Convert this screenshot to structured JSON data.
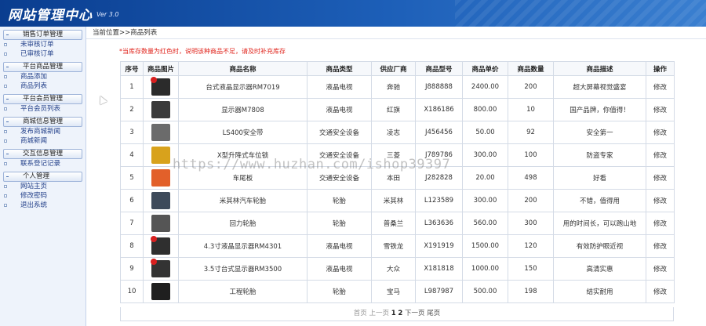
{
  "header": {
    "title": "网站管理中心",
    "version": "Ver 3.0"
  },
  "sidebar": {
    "groups": [
      {
        "title": "销售订单管理",
        "items": [
          "未审核订单",
          "已审核订单"
        ]
      },
      {
        "title": "平台商品管理",
        "items": [
          "商品添加",
          "商品列表"
        ]
      },
      {
        "title": "平台会员管理",
        "items": [
          "平台会员列表"
        ]
      },
      {
        "title": "商城信息管理",
        "items": [
          "发布商城新闻",
          "商城新闻"
        ]
      },
      {
        "title": "交互信息管理",
        "items": [
          "联系登记记录"
        ]
      },
      {
        "title": "个人管理",
        "items": [
          "网站主页",
          "修改密码",
          "退出系统"
        ]
      }
    ]
  },
  "breadcrumb": "当前位置>>商品列表",
  "notice": "*当库存数量为红色时，说明该种商品不足，请及时补充库存",
  "table": {
    "headers": [
      "序号",
      "商品图片",
      "商品名称",
      "商品类型",
      "供应厂商",
      "商品型号",
      "商品单价",
      "商品数量",
      "商品描述",
      "操作"
    ],
    "rows": [
      {
        "no": "1",
        "name": "台式液晶显示器RM7019",
        "type": "液晶电视",
        "vendor": "奔驰",
        "model": "J888888",
        "price": "2400.00",
        "qty": "200",
        "desc": "超大屏幕视觉盛宴",
        "op": "修改",
        "img_color": "#2b2b2b",
        "hot": true,
        "low": false
      },
      {
        "no": "2",
        "name": "显示器M7808",
        "type": "液晶电视",
        "vendor": "红旗",
        "model": "X186186",
        "price": "800.00",
        "qty": "10",
        "desc": "国产品牌，你值得！",
        "op": "修改",
        "img_color": "#3a3a3a",
        "hot": false,
        "low": true
      },
      {
        "no": "3",
        "name": "LS400安全带",
        "type": "交通安全设备",
        "vendor": "凌志",
        "model": "J456456",
        "price": "50.00",
        "qty": "92",
        "desc": "安全第一",
        "op": "修改",
        "img_color": "#6b6b6b",
        "hot": false,
        "low": false
      },
      {
        "no": "4",
        "name": "X型升降式车位锁",
        "type": "交通安全设备",
        "vendor": "三菱",
        "model": "J789786",
        "price": "300.00",
        "qty": "100",
        "desc": "防盗专家",
        "op": "修改",
        "img_color": "#d8a21c",
        "hot": false,
        "low": false
      },
      {
        "no": "5",
        "name": "车尾板",
        "type": "交通安全设备",
        "vendor": "本田",
        "model": "J282828",
        "price": "20.00",
        "qty": "498",
        "desc": "好看",
        "op": "修改",
        "img_color": "#e2602a",
        "hot": false,
        "low": false
      },
      {
        "no": "6",
        "name": "米其林汽车轮胎",
        "type": "轮胎",
        "vendor": "米其林",
        "model": "L123589",
        "price": "300.00",
        "qty": "200",
        "desc": "不错，值得用",
        "op": "修改",
        "img_color": "#3d4a5a",
        "hot": false,
        "low": false
      },
      {
        "no": "7",
        "name": "回力轮胎",
        "type": "轮胎",
        "vendor": "普桑兰",
        "model": "L363636",
        "price": "560.00",
        "qty": "300",
        "desc": "用的时间长，可以跑山地",
        "op": "修改",
        "img_color": "#555555",
        "hot": false,
        "low": false
      },
      {
        "no": "8",
        "name": "4.3寸液晶显示器RM4301",
        "type": "液晶电视",
        "vendor": "雪铁龙",
        "model": "X191919",
        "price": "1500.00",
        "qty": "120",
        "desc": "有效防护眼近视",
        "op": "修改",
        "img_color": "#2f2f2f",
        "hot": true,
        "low": false
      },
      {
        "no": "9",
        "name": "3.5寸台式显示器RM3500",
        "type": "液晶电视",
        "vendor": "大众",
        "model": "X181818",
        "price": "1000.00",
        "qty": "150",
        "desc": "高清实惠",
        "op": "修改",
        "img_color": "#333333",
        "hot": true,
        "low": false
      },
      {
        "no": "10",
        "name": "工程轮胎",
        "type": "轮胎",
        "vendor": "宝马",
        "model": "L987987",
        "price": "500.00",
        "qty": "198",
        "desc": "结实耐用",
        "op": "修改",
        "img_color": "#1f1f1f",
        "hot": false,
        "low": false
      }
    ]
  },
  "pager": {
    "first": "首页",
    "prev": "上一页",
    "page1": "1",
    "page2": "2",
    "next": "下一页",
    "last": "尾页"
  },
  "watermark": "https://www.huzhan.com/ishop39397",
  "colors": {
    "header_start": "#0a3d8f",
    "header_end": "#3a7fd0",
    "alert": "#e0241c",
    "sidebar_bg": "#eef3fb"
  }
}
